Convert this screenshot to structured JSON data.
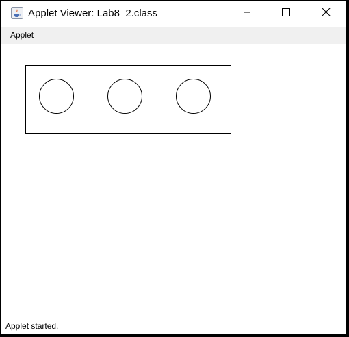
{
  "window": {
    "title": "Applet Viewer: Lab8_2.class",
    "controls": [
      "minimize",
      "maximize",
      "close"
    ]
  },
  "menubar": {
    "items": [
      {
        "label": "Applet"
      }
    ]
  },
  "applet": {
    "drawing": {
      "shapes": [
        "rectangle",
        "circle",
        "circle",
        "circle"
      ]
    }
  },
  "status": {
    "text": "Applet started."
  },
  "icons": {
    "app": "java-cup-icon",
    "minimize": "minimize-icon",
    "maximize": "maximize-icon",
    "close": "close-icon"
  }
}
